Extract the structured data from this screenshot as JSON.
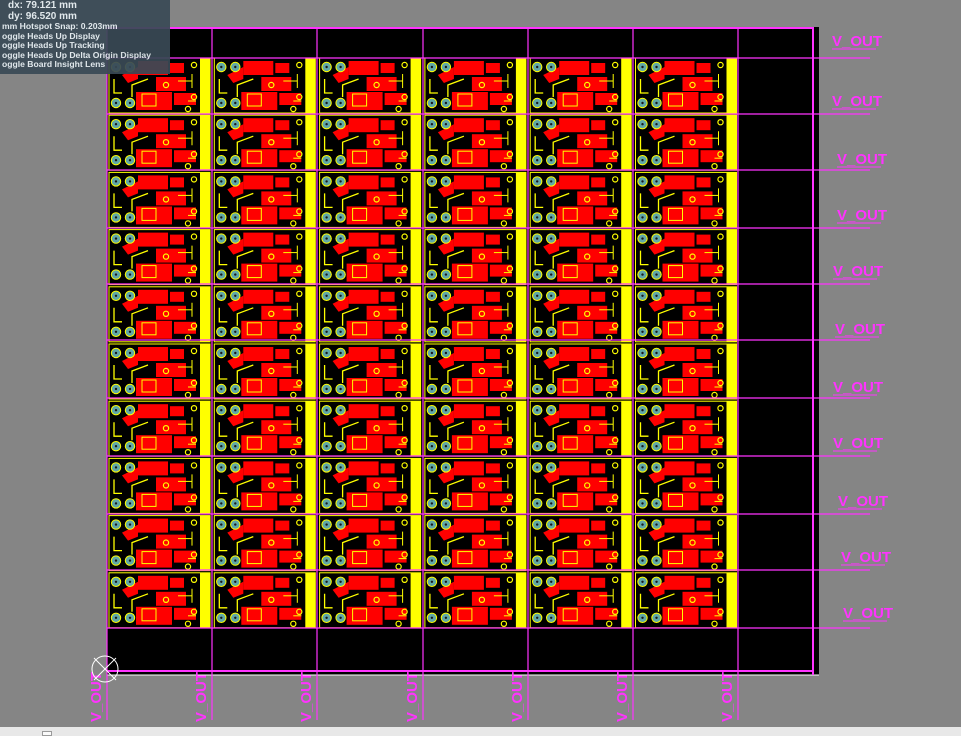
{
  "hud": {
    "dx_line": "dx: 79.121 mm",
    "dy_line": "dy: 96.520 mm",
    "snap_line": "mm Hotspot Snap: 0.203mm",
    "items": [
      "oggle Heads Up Display",
      "oggle Heads Up Tracking",
      "oggle Heads Up Delta Origin Display",
      "oggle Board Insight Lens"
    ]
  },
  "net_label": "V_OUT",
  "right_labels": [
    "V_OUT",
    "V_OUT",
    "V_OUT",
    "V_OUT",
    "V_OUT",
    "V_OUT",
    "V_OUT",
    "V_OUT",
    "V_OUT",
    "V_OUT",
    "V_OUT"
  ],
  "bottom_labels": [
    "V_OUT",
    "V_OUT",
    "V_OUT",
    "V_OUT",
    "V_OUT",
    "V_OUT",
    "V_OUT"
  ],
  "panel": {
    "rows": 10,
    "cols": 6
  },
  "colors": {
    "workspace": "#858585",
    "board": "#000000",
    "top_copper": "#ff0000",
    "silkscreen": "#ffff00",
    "net_line": "#ff33ff",
    "pad": "#5fa8a8",
    "hud_bg": "#3a4a56"
  },
  "icons": {
    "origin_marker": "origin-crosshair-icon"
  }
}
